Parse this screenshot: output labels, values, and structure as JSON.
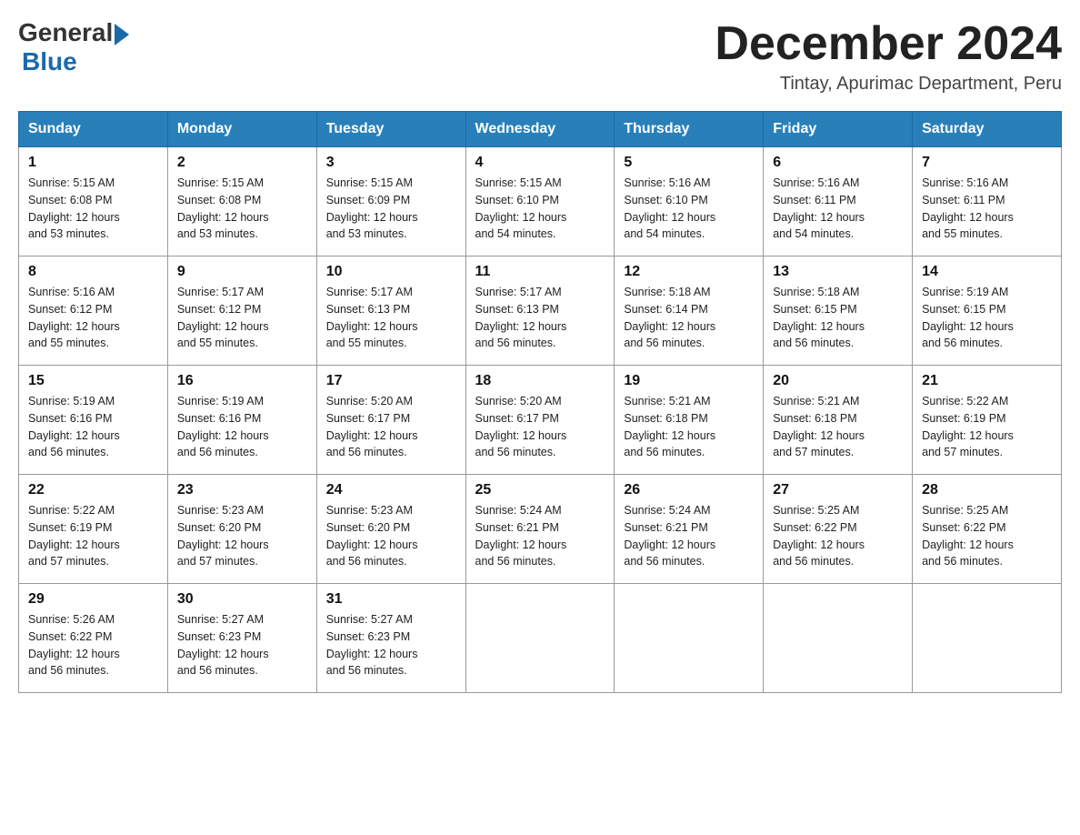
{
  "logo": {
    "general": "General",
    "blue": "Blue"
  },
  "title": "December 2024",
  "location": "Tintay, Apurimac Department, Peru",
  "days_of_week": [
    "Sunday",
    "Monday",
    "Tuesday",
    "Wednesday",
    "Thursday",
    "Friday",
    "Saturday"
  ],
  "weeks": [
    [
      {
        "day": "1",
        "sunrise": "5:15 AM",
        "sunset": "6:08 PM",
        "daylight": "12 hours and 53 minutes."
      },
      {
        "day": "2",
        "sunrise": "5:15 AM",
        "sunset": "6:08 PM",
        "daylight": "12 hours and 53 minutes."
      },
      {
        "day": "3",
        "sunrise": "5:15 AM",
        "sunset": "6:09 PM",
        "daylight": "12 hours and 53 minutes."
      },
      {
        "day": "4",
        "sunrise": "5:15 AM",
        "sunset": "6:10 PM",
        "daylight": "12 hours and 54 minutes."
      },
      {
        "day": "5",
        "sunrise": "5:16 AM",
        "sunset": "6:10 PM",
        "daylight": "12 hours and 54 minutes."
      },
      {
        "day": "6",
        "sunrise": "5:16 AM",
        "sunset": "6:11 PM",
        "daylight": "12 hours and 54 minutes."
      },
      {
        "day": "7",
        "sunrise": "5:16 AM",
        "sunset": "6:11 PM",
        "daylight": "12 hours and 55 minutes."
      }
    ],
    [
      {
        "day": "8",
        "sunrise": "5:16 AM",
        "sunset": "6:12 PM",
        "daylight": "12 hours and 55 minutes."
      },
      {
        "day": "9",
        "sunrise": "5:17 AM",
        "sunset": "6:12 PM",
        "daylight": "12 hours and 55 minutes."
      },
      {
        "day": "10",
        "sunrise": "5:17 AM",
        "sunset": "6:13 PM",
        "daylight": "12 hours and 55 minutes."
      },
      {
        "day": "11",
        "sunrise": "5:17 AM",
        "sunset": "6:13 PM",
        "daylight": "12 hours and 56 minutes."
      },
      {
        "day": "12",
        "sunrise": "5:18 AM",
        "sunset": "6:14 PM",
        "daylight": "12 hours and 56 minutes."
      },
      {
        "day": "13",
        "sunrise": "5:18 AM",
        "sunset": "6:15 PM",
        "daylight": "12 hours and 56 minutes."
      },
      {
        "day": "14",
        "sunrise": "5:19 AM",
        "sunset": "6:15 PM",
        "daylight": "12 hours and 56 minutes."
      }
    ],
    [
      {
        "day": "15",
        "sunrise": "5:19 AM",
        "sunset": "6:16 PM",
        "daylight": "12 hours and 56 minutes."
      },
      {
        "day": "16",
        "sunrise": "5:19 AM",
        "sunset": "6:16 PM",
        "daylight": "12 hours and 56 minutes."
      },
      {
        "day": "17",
        "sunrise": "5:20 AM",
        "sunset": "6:17 PM",
        "daylight": "12 hours and 56 minutes."
      },
      {
        "day": "18",
        "sunrise": "5:20 AM",
        "sunset": "6:17 PM",
        "daylight": "12 hours and 56 minutes."
      },
      {
        "day": "19",
        "sunrise": "5:21 AM",
        "sunset": "6:18 PM",
        "daylight": "12 hours and 56 minutes."
      },
      {
        "day": "20",
        "sunrise": "5:21 AM",
        "sunset": "6:18 PM",
        "daylight": "12 hours and 57 minutes."
      },
      {
        "day": "21",
        "sunrise": "5:22 AM",
        "sunset": "6:19 PM",
        "daylight": "12 hours and 57 minutes."
      }
    ],
    [
      {
        "day": "22",
        "sunrise": "5:22 AM",
        "sunset": "6:19 PM",
        "daylight": "12 hours and 57 minutes."
      },
      {
        "day": "23",
        "sunrise": "5:23 AM",
        "sunset": "6:20 PM",
        "daylight": "12 hours and 57 minutes."
      },
      {
        "day": "24",
        "sunrise": "5:23 AM",
        "sunset": "6:20 PM",
        "daylight": "12 hours and 56 minutes."
      },
      {
        "day": "25",
        "sunrise": "5:24 AM",
        "sunset": "6:21 PM",
        "daylight": "12 hours and 56 minutes."
      },
      {
        "day": "26",
        "sunrise": "5:24 AM",
        "sunset": "6:21 PM",
        "daylight": "12 hours and 56 minutes."
      },
      {
        "day": "27",
        "sunrise": "5:25 AM",
        "sunset": "6:22 PM",
        "daylight": "12 hours and 56 minutes."
      },
      {
        "day": "28",
        "sunrise": "5:25 AM",
        "sunset": "6:22 PM",
        "daylight": "12 hours and 56 minutes."
      }
    ],
    [
      {
        "day": "29",
        "sunrise": "5:26 AM",
        "sunset": "6:22 PM",
        "daylight": "12 hours and 56 minutes."
      },
      {
        "day": "30",
        "sunrise": "5:27 AM",
        "sunset": "6:23 PM",
        "daylight": "12 hours and 56 minutes."
      },
      {
        "day": "31",
        "sunrise": "5:27 AM",
        "sunset": "6:23 PM",
        "daylight": "12 hours and 56 minutes."
      },
      null,
      null,
      null,
      null
    ]
  ],
  "labels": {
    "sunrise": "Sunrise:",
    "sunset": "Sunset:",
    "daylight": "Daylight:"
  }
}
